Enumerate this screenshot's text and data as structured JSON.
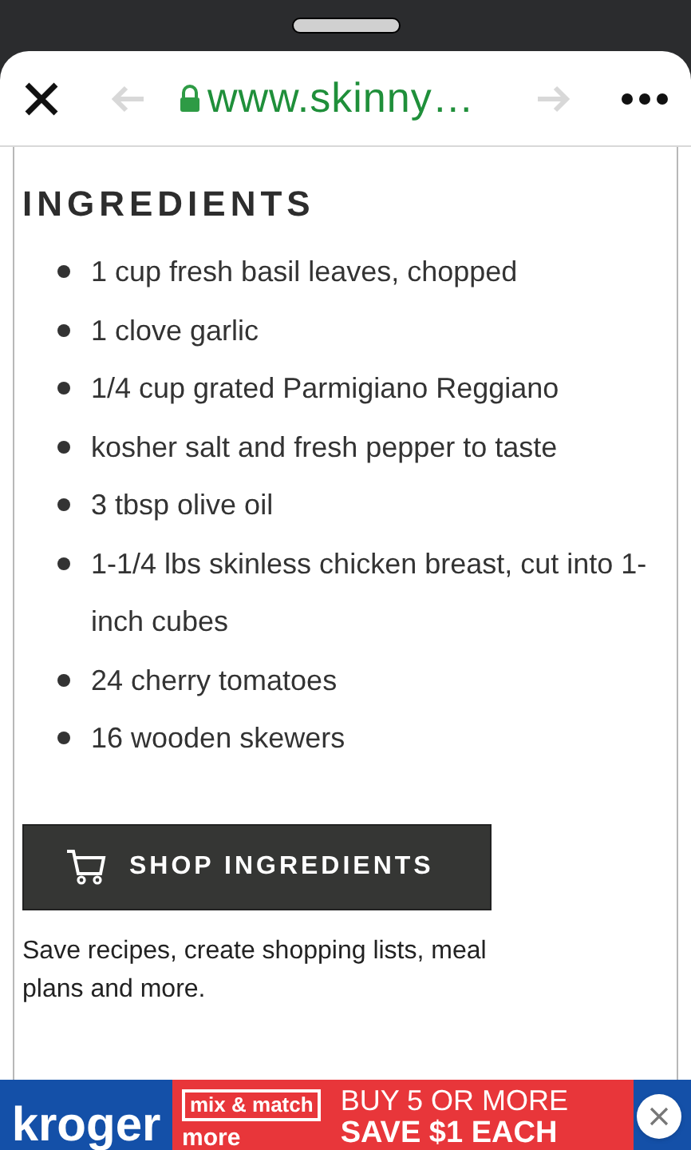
{
  "browser": {
    "url": "www.skinny…"
  },
  "heading": "INGREDIENTS",
  "ingredients": [
    "1 cup fresh basil leaves, chopped",
    "1 clove garlic",
    "1/4 cup grated Parmigiano Reggiano",
    "kosher salt and fresh pepper to taste",
    "3 tbsp olive oil",
    "1-1/4 lbs skinless chicken breast, cut into 1-inch cubes",
    "24 cherry tomatoes",
    "16 wooden skewers"
  ],
  "shop_button": "SHOP INGREDIENTS",
  "note": "Save recipes, create shopping lists, meal plans and more.",
  "ad": {
    "brand": "kroger",
    "tag": "mix & match",
    "tag_sub": "more",
    "line1": "BUY 5 OR MORE",
    "line2": "SAVE $1 EACH"
  }
}
